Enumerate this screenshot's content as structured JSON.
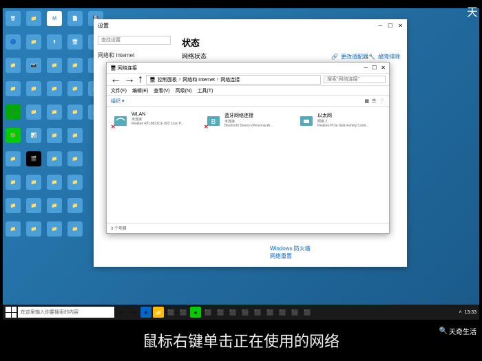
{
  "watermark_tr": "天",
  "watermark_br": "天奇生活",
  "subtitle": "鼠标右键单击正在使用的网络",
  "taskbar": {
    "search_placeholder": "在这里输入你要搜索的内容",
    "time": "13:33"
  },
  "settings": {
    "title": "设置",
    "search_placeholder": "查找设置",
    "category": "网络和 Internet",
    "heading": "状态",
    "subheading": "网络状态",
    "link1": "故障排除",
    "link2": "更改适配器",
    "bottom_link1": "Windows 防火墙",
    "bottom_link2": "网络重置"
  },
  "explorer": {
    "title": "网络连接",
    "breadcrumb": [
      "控制面板",
      "网络和 Internet",
      "网络连接"
    ],
    "search_placeholder": "搜索\"网络连接\"",
    "menu": [
      "文件(F)",
      "编辑(E)",
      "查看(V)",
      "高级(N)",
      "工具(T)"
    ],
    "adapters": [
      {
        "name": "WLAN",
        "sub": "未连接",
        "desc": "Realtek RTL8821CE 802.11ac P...",
        "badge": "✕",
        "badge_class": "badge-red"
      },
      {
        "name": "蓝牙网络连接",
        "sub": "未连接",
        "desc": "Bluetooth Device (Personal Ar...",
        "badge": "✕",
        "badge_class": "badge-red"
      },
      {
        "name": "以太网",
        "sub": "网络 2",
        "desc": "Realtek PCIe GbE Family Contr...",
        "badge": "",
        "badge_class": ""
      }
    ],
    "status": "3 个项目"
  },
  "desktop_icons": [
    "🗑",
    "📁",
    "M",
    "📄",
    "💾",
    "🔵",
    "📁",
    "⬆",
    "🖥",
    "📁",
    "📁",
    "📷",
    "📁",
    "📁",
    "⚙",
    "📁",
    "📁",
    "📁",
    "📁",
    "📁",
    "🎵",
    "📁",
    "📁",
    "📁",
    "📁",
    "🟢",
    "📊",
    "📁",
    "📁",
    "",
    "📁",
    "🎬",
    "📁",
    "📁",
    "",
    "📁",
    "📁",
    "📁",
    "📁",
    "",
    "📁",
    "📁",
    "📁",
    "📁",
    "",
    "📁",
    "📁",
    "📁",
    "📁",
    ""
  ]
}
